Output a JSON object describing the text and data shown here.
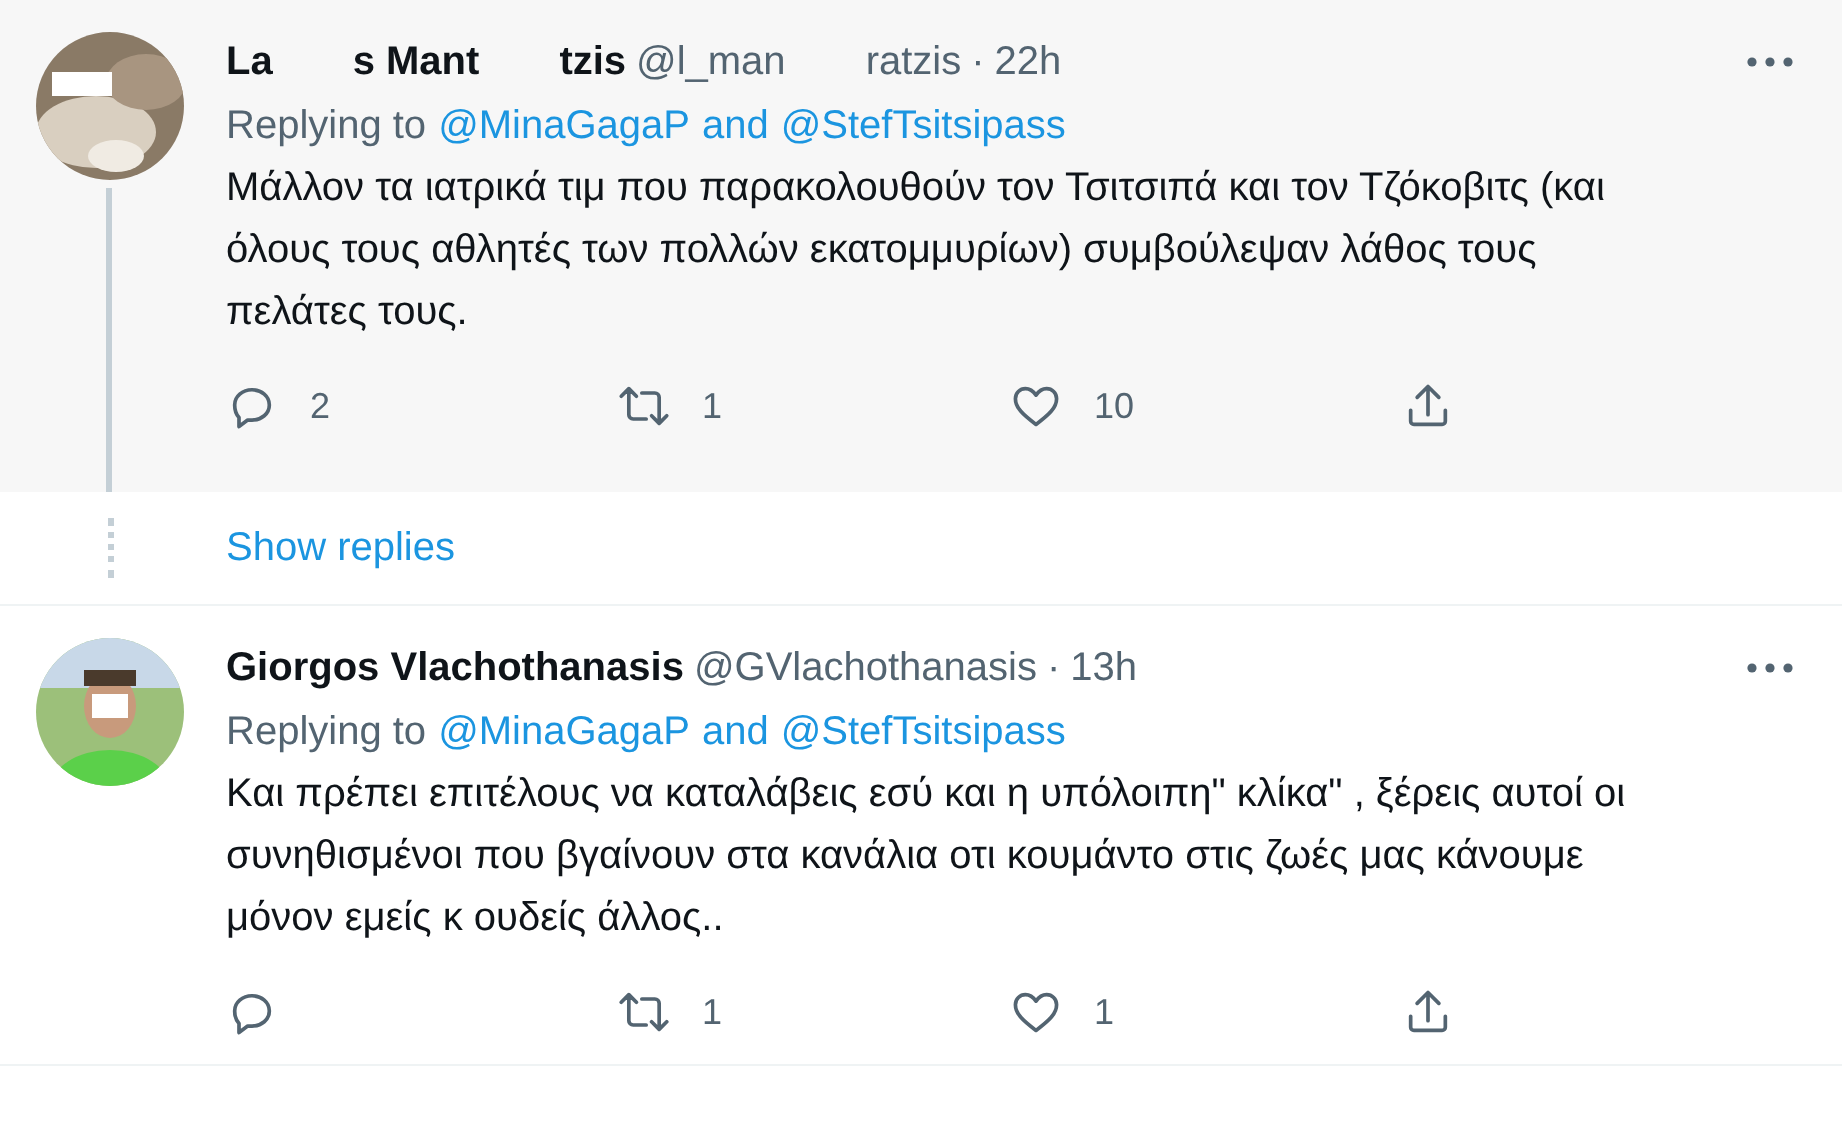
{
  "tweets": [
    {
      "author": {
        "name_parts": [
          "La",
          "s Mant",
          "tzis"
        ],
        "handle_parts": [
          "@l_man",
          "ratzis"
        ]
      },
      "separator": "·",
      "time": "22h",
      "highlighted": true,
      "thread_line": true,
      "replying_label": "Replying to",
      "mentions": [
        "@MinaGagaP",
        "@StefTsitsipass"
      ],
      "joiner": "and",
      "text": "Μάλλον τα ιατρικά τιμ που παρακολουθούν τον Τσιτσιπά και τον Τζόκοβιτς (και όλους τους αθλητές των πολλών εκατομμυρίων) συμβούλεψαν λάθος τους πελάτες τους.",
      "actions": [
        {
          "kind": "reply",
          "count": "2"
        },
        {
          "kind": "retweet",
          "count": "1"
        },
        {
          "kind": "like",
          "count": "10"
        },
        {
          "kind": "share"
        }
      ]
    },
    {
      "author": {
        "name_parts": [
          "Giorgos Vlachothanasis"
        ],
        "handle_parts": [
          "@GVlachothanasis"
        ]
      },
      "separator": "·",
      "time": "13h",
      "highlighted": false,
      "thread_line": false,
      "replying_label": "Replying to",
      "mentions": [
        "@MinaGagaP",
        "@StefTsitsipass"
      ],
      "joiner": "and",
      "text": "Και πρέπει επιτέλους να καταλάβεις εσύ και η υπόλοιπη\" κλίκα\" , ξέρεις αυτοί οι συνηθισμένοι που βγαίνουν στα κανάλια οτι κουμάντο στις ζωές μας κάνουμε μόνον εμείς κ ουδείς άλλος..",
      "actions": [
        {
          "kind": "reply"
        },
        {
          "kind": "retweet",
          "count": "1"
        },
        {
          "kind": "like",
          "count": "1"
        },
        {
          "kind": "share"
        }
      ]
    }
  ],
  "show_replies": "Show replies"
}
